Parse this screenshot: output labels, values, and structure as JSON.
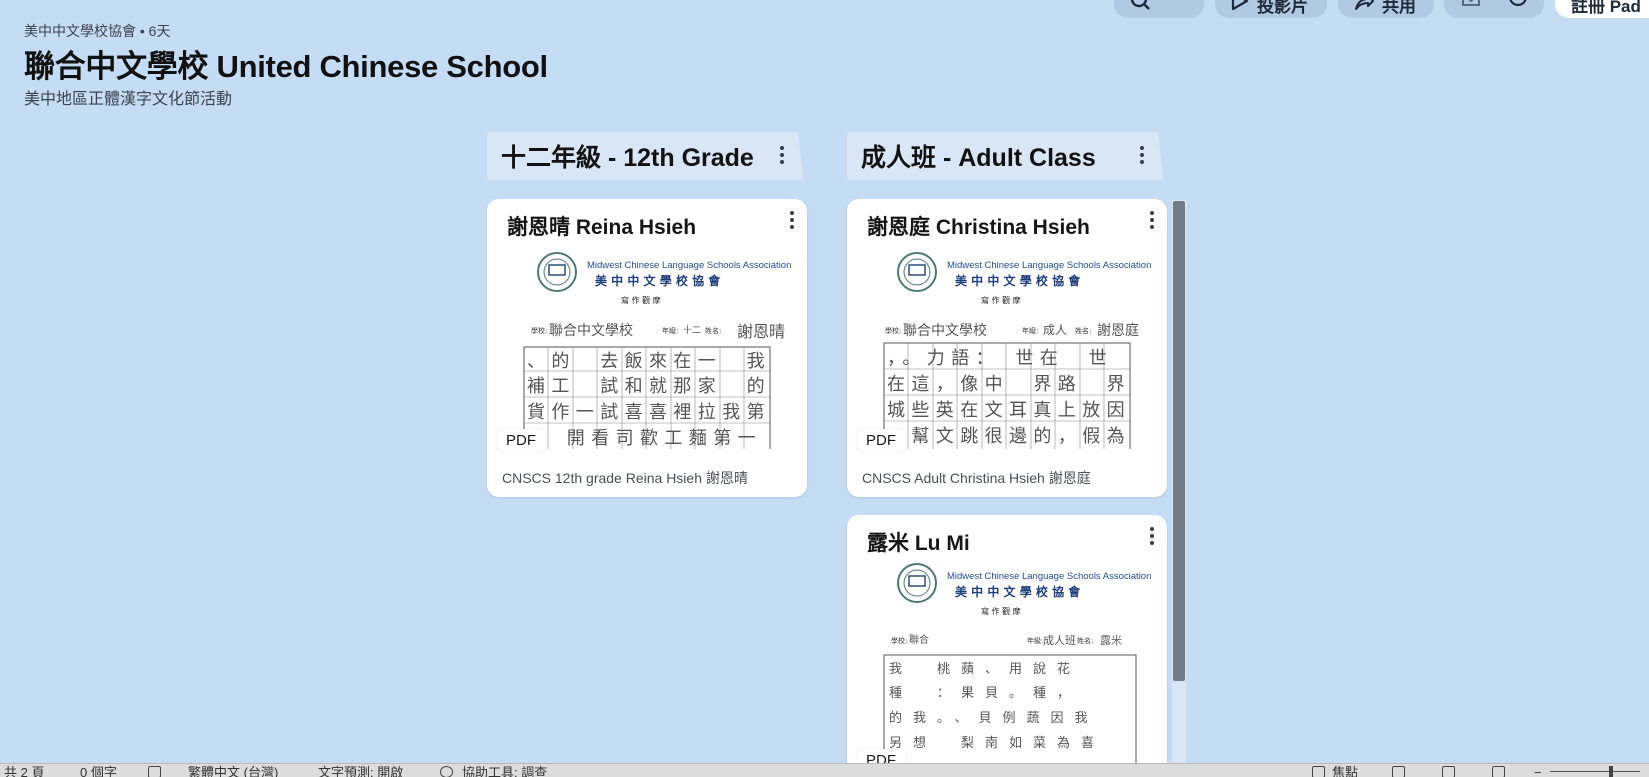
{
  "toolbar": {
    "slideshow_label": "投影片",
    "share_label": "共用",
    "signin_label": "註冊 Pad"
  },
  "board": {
    "meta": "美中中文學校協會 • 6天",
    "title": "聯合中文學校 United Chinese School",
    "description": "美中地區正體漢字文化節活動"
  },
  "sections": [
    {
      "title": "十二年級 - 12th Grade",
      "cards": [
        {
          "title": "謝恩晴 Reina Hsieh",
          "badge": "PDF",
          "caption": "CNSCS 12th grade Reina Hsieh 謝恩晴",
          "doc": {
            "assoc_en": "Midwest Chinese Language Schools Association",
            "assoc_zh": "美 中 中 文 學 校 協 會",
            "event": "寫 作 觀 摩",
            "school_label": "學校:",
            "school": "聯合中文學校",
            "grade_label": "年級:",
            "grade": "十二",
            "name_label": "姓名:",
            "name": "謝恩晴",
            "grid": [
              "、的　去飯來在一　我",
              "補工　試和就那家　的",
              "貨作一試喜喜裡拉我第",
              "：　開看司歡工麵第一"
            ]
          }
        }
      ]
    },
    {
      "title": "成人班 - Adult Class",
      "cards": [
        {
          "title": "謝恩庭 Christina Hsieh",
          "badge": "PDF",
          "caption": "CNSCS Adult Christina Hsieh 謝恩庭",
          "doc": {
            "assoc_en": "Midwest Chinese Language Schools Association",
            "assoc_zh": "美 中 中 文 學 校 協 會",
            "event": "寫 作 觀 摩",
            "school_label": "學校:",
            "school": "聯合中文學校",
            "grade_label": "年級:",
            "grade": "成人",
            "name_label": "姓名:",
            "name": "謝恩庭",
            "grid": [
              "，。力語：　世在　世",
              "在這，像中　界路　界",
              "城些英在文耳真上放因",
              "　幫文跳很邊的，假為"
            ]
          }
        },
        {
          "title": "露米 Lu Mi",
          "badge": "PDF",
          "caption": "",
          "doc": {
            "assoc_en": "Midwest Chinese Language Schools Association",
            "assoc_zh": "美 中 中 文 學 校 協 會",
            "event": "寫 作 觀 摩",
            "school_label": "學校:",
            "school": "聯合",
            "grade_label": "年級:",
            "grade": "成人班",
            "name_label": "姓名:",
            "name": "露米",
            "grid": [
              "我　桃蘋、用說花",
              "種　：果貝。種，",
              "的我。、貝例蔬因我",
              "另想　梨南如菜為喜"
            ]
          }
        }
      ]
    }
  ],
  "statusbar": {
    "pages": "共 2 頁",
    "words": "0 個字",
    "language": "繁體中文 (台灣)",
    "prediction": "文字預測: 開啟",
    "accessibility": "協助工具: 調查",
    "focus": "焦點"
  }
}
